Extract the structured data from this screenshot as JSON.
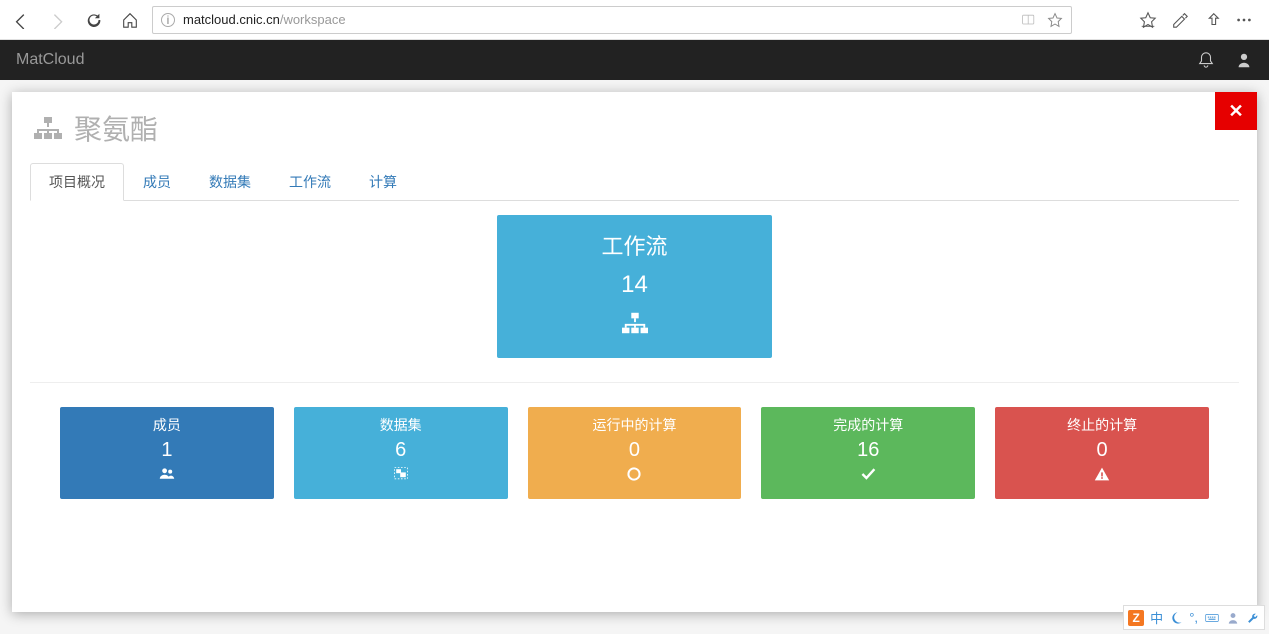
{
  "browser": {
    "url_host": "matcloud.cnic.cn",
    "url_path": "/workspace"
  },
  "app": {
    "name": "MatCloud"
  },
  "project": {
    "title": "聚氨酯"
  },
  "tabs": [
    {
      "label": "项目概况",
      "active": true
    },
    {
      "label": "成员",
      "active": false
    },
    {
      "label": "数据集",
      "active": false
    },
    {
      "label": "工作流",
      "active": false
    },
    {
      "label": "计算",
      "active": false
    }
  ],
  "hero": {
    "title": "工作流",
    "value": "14"
  },
  "stats": [
    {
      "title": "成员",
      "value": "1",
      "icon": "users",
      "color": "c-blue"
    },
    {
      "title": "数据集",
      "value": "6",
      "icon": "objgroup",
      "color": "c-cyan"
    },
    {
      "title": "运行中的计算",
      "value": "0",
      "icon": "spinner",
      "color": "c-orange"
    },
    {
      "title": "完成的计算",
      "value": "16",
      "icon": "check",
      "color": "c-green"
    },
    {
      "title": "终止的计算",
      "value": "0",
      "icon": "warning",
      "color": "c-red"
    }
  ],
  "tray": {
    "ime": "中"
  }
}
